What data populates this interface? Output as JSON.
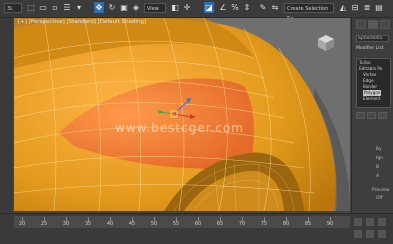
{
  "toolbar": {
    "undo_dropdown": "3L",
    "view_dropdown": "View",
    "selection_set": "Create Selection Se",
    "icons": [
      "select-icon",
      "select-region-icon",
      "move-icon",
      "rotate-icon",
      "scale-icon",
      "reference-coord-icon",
      "pivot-icon",
      "select-manipulate-icon",
      "keyboard-shortcut-icon",
      "snap-icon",
      "angle-snap-icon",
      "percent-snap-icon",
      "spinner-snap-icon",
      "edit-named-sets-icon",
      "mirror-icon",
      "align-icon",
      "layer-icon",
      "graphite-icon",
      "curve-editor-icon",
      "schematic-icon",
      "material-editor-icon",
      "render-setup-icon",
      "render-frame-icon",
      "render-icon"
    ]
  },
  "viewport": {
    "label": "[+] [Perspective] [Standard] [Default Shading]",
    "watermark": "www.bestcger.com"
  },
  "command_panel": {
    "object_name": "Sphere001",
    "modifier_list": "Modifier List",
    "stack": [
      {
        "label": "Turbo",
        "selected": false
      },
      {
        "label": "Editable Po",
        "selected": false
      },
      {
        "label": "Vertex",
        "selected": false
      },
      {
        "label": "Edge",
        "selected": false
      },
      {
        "label": "Border",
        "selected": false
      },
      {
        "label": "Polygon",
        "selected": true
      },
      {
        "label": "Element",
        "selected": false
      }
    ],
    "options": [
      "By",
      "Ign",
      "B",
      "A",
      "Preview",
      "Off"
    ]
  },
  "timeline": {
    "ticks": [
      "20",
      "25",
      "30",
      "35",
      "40",
      "45",
      "50",
      "55",
      "60",
      "65",
      "70",
      "75",
      "80",
      "85",
      "90"
    ]
  },
  "colors": {
    "selection_orange": "#e8a21a",
    "face_selected": "#f2823a",
    "active_tool": "#2f6fb0"
  }
}
